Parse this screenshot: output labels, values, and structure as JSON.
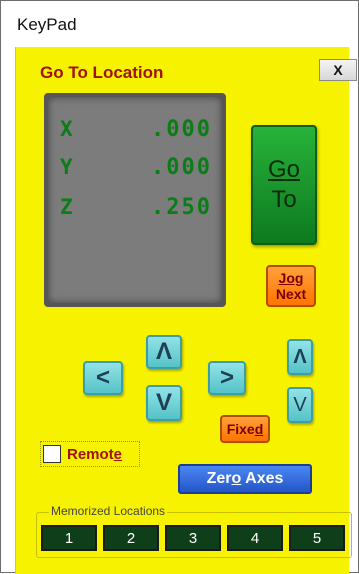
{
  "window": {
    "title": "KeyPad"
  },
  "panel": {
    "title": "Go To Location",
    "close_label": "X"
  },
  "readout": {
    "rows": [
      {
        "axis": "X",
        "value": ".000"
      },
      {
        "axis": "Y",
        "value": ".000"
      },
      {
        "axis": "Z",
        "value": ".250"
      }
    ]
  },
  "buttons": {
    "goto_line1": "Go",
    "goto_line2": "To",
    "jog_line1": "Jog",
    "jog_line2": "Next",
    "left": "<",
    "right": ">",
    "up": "Λ",
    "down": "V",
    "z_up": "Λ",
    "z_down": "V",
    "fixed_pre": "Fixe",
    "fixed_ul": "d",
    "zero_pre": "Zer",
    "zero_ul": "o",
    "zero_post": " Axes"
  },
  "remote": {
    "label_pre": "Remot",
    "label_ul": "e",
    "checked": false
  },
  "memorized": {
    "label": "Memorized Locations",
    "items": [
      "1",
      "2",
      "3",
      "4",
      "5"
    ]
  },
  "colors": {
    "panel": "#f7f200",
    "title_red": "#a01212",
    "readout_green": "#0b7d17",
    "go_green": "#1a9a2c",
    "orange": "#ff8a10",
    "cyan": "#6fd2d6",
    "blue": "#2f6ae0",
    "memo_dark_green": "#0f3f1a"
  }
}
